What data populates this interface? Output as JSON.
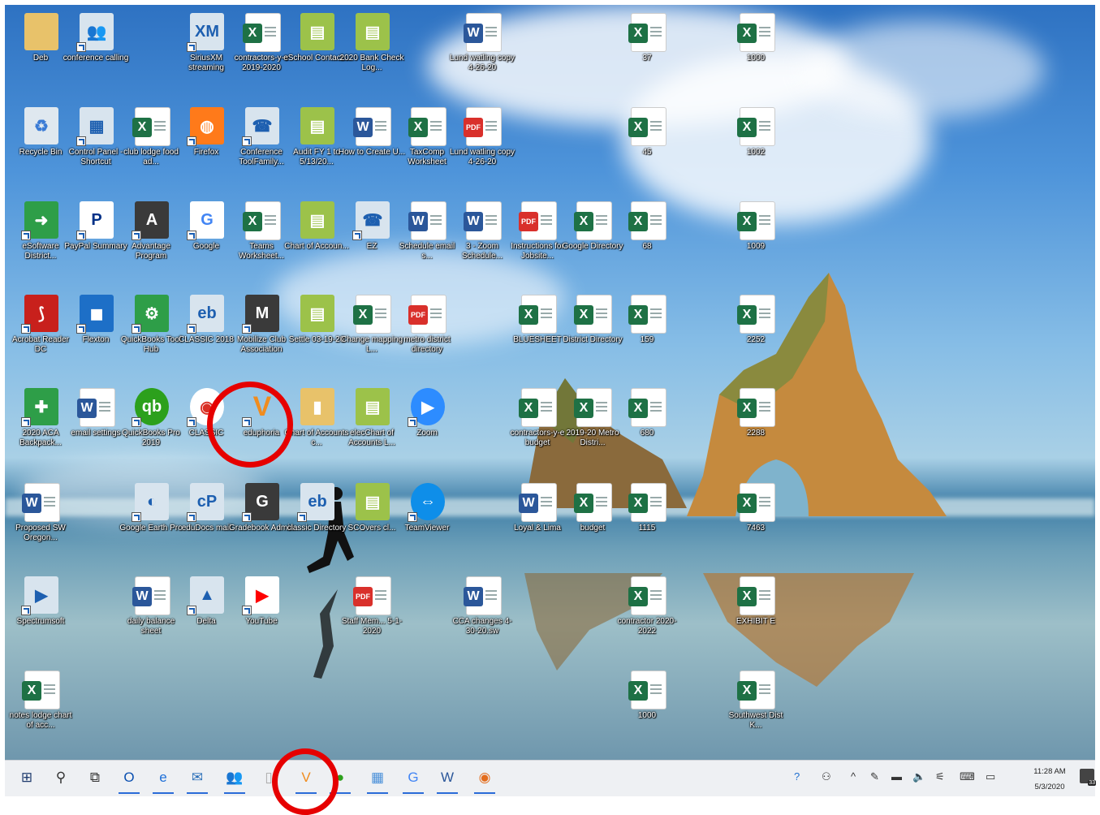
{
  "desktop": {
    "icons": [
      {
        "label": "Deb",
        "icon": "folder-icon",
        "type": "folder",
        "col": 0,
        "row": 0
      },
      {
        "label": "conference calling",
        "icon": "people-icon",
        "type": "app",
        "col": 1,
        "row": 0
      },
      {
        "label": "SiriusXM streaming",
        "icon": "sxm-icon",
        "type": "app",
        "col": 3,
        "row": 0
      },
      {
        "label": "contractors-y-e 2019-2020",
        "icon": "excel-icon",
        "type": "excel",
        "col": 4,
        "row": 0
      },
      {
        "label": "eSchool Contact...",
        "icon": "book-icon",
        "type": "book",
        "col": 5,
        "row": 0
      },
      {
        "label": "2020 Bank Check Log...",
        "icon": "book-icon",
        "type": "book",
        "col": 6,
        "row": 0
      },
      {
        "label": "Lund watling copy 4-26-20",
        "icon": "word-icon",
        "type": "word",
        "col": 8,
        "row": 0
      },
      {
        "label": "37",
        "icon": "excel-icon",
        "type": "excel",
        "col": 11,
        "row": 0
      },
      {
        "label": "1000",
        "icon": "excel-icon",
        "type": "excel",
        "col": 13,
        "row": 0
      },
      {
        "label": "Recycle Bin",
        "icon": "recycle-bin-icon",
        "type": "bin",
        "col": 0,
        "row": 1
      },
      {
        "label": "Control Panel - Shortcut",
        "icon": "control-panel-icon",
        "type": "app",
        "col": 1,
        "row": 1
      },
      {
        "label": "club lodge food ad...",
        "icon": "excel-icon",
        "type": "excel",
        "col": 2,
        "row": 1
      },
      {
        "label": "Firefox",
        "icon": "firefox-icon",
        "type": "firefox",
        "col": 3,
        "row": 1
      },
      {
        "label": "Conference ToolFamily...",
        "icon": "phone-icon",
        "type": "app",
        "col": 4,
        "row": 1
      },
      {
        "label": "Audit FY 1 to 5/13/20...",
        "icon": "book-icon",
        "type": "book",
        "col": 5,
        "row": 1
      },
      {
        "label": "How to Create U...",
        "icon": "word-icon",
        "type": "word",
        "col": 6,
        "row": 1
      },
      {
        "label": "TaxComp Worksheet",
        "icon": "excel-icon",
        "type": "excel",
        "col": 7,
        "row": 1
      },
      {
        "label": "Lund watling copy 4-26-20",
        "icon": "pdf-icon",
        "type": "pdf",
        "col": 8,
        "row": 1
      },
      {
        "label": "45",
        "icon": "excel-icon",
        "type": "excel",
        "col": 11,
        "row": 1
      },
      {
        "label": "1002",
        "icon": "excel-icon",
        "type": "excel",
        "col": 13,
        "row": 1
      },
      {
        "label": "eSoftware District...",
        "icon": "arrow-icon",
        "type": "green",
        "col": 0,
        "row": 2
      },
      {
        "label": "PayPal Summary",
        "icon": "paypal-icon",
        "type": "paypal",
        "col": 1,
        "row": 2
      },
      {
        "label": "Advantage Program",
        "icon": "letter-a-icon",
        "type": "dark",
        "col": 2,
        "row": 2
      },
      {
        "label": "Google",
        "icon": "google-icon",
        "type": "google",
        "col": 3,
        "row": 2
      },
      {
        "label": "Teams Worksheet...",
        "icon": "excel-icon",
        "type": "excel",
        "col": 4,
        "row": 2
      },
      {
        "label": "Chart of Accoun...",
        "icon": "book-icon",
        "type": "book",
        "col": 5,
        "row": 2
      },
      {
        "label": "EZ",
        "icon": "phone-icon",
        "type": "app",
        "col": 6,
        "row": 2
      },
      {
        "label": "Schedule email s...",
        "icon": "word-icon",
        "type": "word",
        "col": 7,
        "row": 2
      },
      {
        "label": "3 - Zoom Schedule...",
        "icon": "word-icon",
        "type": "word",
        "col": 8,
        "row": 2
      },
      {
        "label": "Instructions for Jobsite...",
        "icon": "pdf-icon",
        "type": "pdf",
        "col": 9,
        "row": 2
      },
      {
        "label": "Google Directory",
        "icon": "excel-icon",
        "type": "excel",
        "col": 10,
        "row": 2
      },
      {
        "label": "68",
        "icon": "excel-icon",
        "type": "excel",
        "col": 11,
        "row": 2
      },
      {
        "label": "1009",
        "icon": "excel-icon",
        "type": "excel",
        "col": 13,
        "row": 2
      },
      {
        "label": "Acrobat Reader DC",
        "icon": "acrobat-icon",
        "type": "acrobat",
        "col": 0,
        "row": 3
      },
      {
        "label": "Flexton",
        "icon": "window-icon",
        "type": "blue",
        "col": 1,
        "row": 3
      },
      {
        "label": "QuickBooks Tool Hub",
        "icon": "quickbooks-hub-icon",
        "type": "green",
        "col": 2,
        "row": 3
      },
      {
        "label": "CLASSIC 2018",
        "icon": "classic-icon",
        "type": "app",
        "col": 3,
        "row": 3
      },
      {
        "label": "Mobilize Club Association",
        "icon": "letter-m-icon",
        "type": "dark",
        "col": 4,
        "row": 3
      },
      {
        "label": "Settle 03-19-20",
        "icon": "book-icon",
        "type": "book",
        "col": 5,
        "row": 3
      },
      {
        "label": "Change mapping L...",
        "icon": "excel-icon",
        "type": "excel",
        "col": 6,
        "row": 3
      },
      {
        "label": "metro district directory",
        "icon": "pdf-icon",
        "type": "pdf",
        "col": 7,
        "row": 3
      },
      {
        "label": "BLUESHEET",
        "icon": "excel-icon",
        "type": "excel",
        "col": 9,
        "row": 3
      },
      {
        "label": "District Directory",
        "icon": "excel-icon",
        "type": "excel",
        "col": 10,
        "row": 3
      },
      {
        "label": "159",
        "icon": "excel-icon",
        "type": "excel",
        "col": 11,
        "row": 3
      },
      {
        "label": "2252",
        "icon": "excel-icon",
        "type": "excel",
        "col": 13,
        "row": 3
      },
      {
        "label": "2020 ACA Backpack...",
        "icon": "cross-icon",
        "type": "green",
        "col": 0,
        "row": 4
      },
      {
        "label": "email settings",
        "icon": "word-icon",
        "type": "word",
        "col": 1,
        "row": 4
      },
      {
        "label": "QuickBooks Pro 2019",
        "icon": "quickbooks-icon",
        "type": "qb",
        "col": 2,
        "row": 4
      },
      {
        "label": "CLASSIC",
        "icon": "chrome-icon",
        "type": "chrome",
        "col": 3,
        "row": 4
      },
      {
        "label": "eduphoria",
        "icon": "eduphoria-icon",
        "type": "eduphoria",
        "col": 4,
        "row": 4
      },
      {
        "label": "Chart of Accounts c...",
        "icon": "zip-folder-icon",
        "type": "folder",
        "col": 5,
        "row": 4
      },
      {
        "label": "elecChart of Accounts L...",
        "icon": "book-icon",
        "type": "book",
        "col": 6,
        "row": 4
      },
      {
        "label": "Zoom",
        "icon": "zoom-icon",
        "type": "zoom",
        "col": 7,
        "row": 4
      },
      {
        "label": "contractors-y-e budget",
        "icon": "excel-icon",
        "type": "excel",
        "col": 9,
        "row": 4
      },
      {
        "label": "2019-20 Metro Distri...",
        "icon": "excel-icon",
        "type": "excel",
        "col": 10,
        "row": 4
      },
      {
        "label": "680",
        "icon": "excel-icon",
        "type": "excel",
        "col": 11,
        "row": 4
      },
      {
        "label": "2288",
        "icon": "excel-icon",
        "type": "excel",
        "col": 13,
        "row": 4
      },
      {
        "label": "Proposed SW Oregon...",
        "icon": "word-icon",
        "type": "word",
        "col": 0,
        "row": 5
      },
      {
        "label": "Google Earth Pro",
        "icon": "google-earth-icon",
        "type": "app",
        "col": 2,
        "row": 5
      },
      {
        "label": "eduDocs mail",
        "icon": "cp-icon",
        "type": "app",
        "col": 3,
        "row": 5
      },
      {
        "label": "Gradebook Admin",
        "icon": "letter-g-icon",
        "type": "dark",
        "col": 4,
        "row": 5
      },
      {
        "label": "classic Directory",
        "icon": "classic-icon",
        "type": "app",
        "col": 5,
        "row": 5
      },
      {
        "label": "SCOvers cl...",
        "icon": "book-icon",
        "type": "book",
        "col": 6,
        "row": 5
      },
      {
        "label": "TeamViewer",
        "icon": "teamviewer-icon",
        "type": "teamviewer",
        "col": 7,
        "row": 5
      },
      {
        "label": "Loyal & Lima",
        "icon": "word-icon",
        "type": "word",
        "col": 9,
        "row": 5
      },
      {
        "label": "budget",
        "icon": "excel-icon",
        "type": "excel",
        "col": 10,
        "row": 5
      },
      {
        "label": "1115",
        "icon": "excel-icon",
        "type": "excel",
        "col": 11,
        "row": 5
      },
      {
        "label": "7463",
        "icon": "excel-icon",
        "type": "excel",
        "col": 13,
        "row": 5
      },
      {
        "label": "Spectrumsoft",
        "icon": "play-arrow-icon",
        "type": "app",
        "col": 0,
        "row": 6
      },
      {
        "label": "daily balance sheet",
        "icon": "word-icon",
        "type": "word",
        "col": 2,
        "row": 6
      },
      {
        "label": "Delta",
        "icon": "delta-icon",
        "type": "app",
        "col": 3,
        "row": 6
      },
      {
        "label": "YouTube",
        "icon": "youtube-icon",
        "type": "youtube",
        "col": 4,
        "row": 6
      },
      {
        "label": "Staff Mem... 5-1-2020",
        "icon": "pdf-icon",
        "type": "pdf",
        "col": 6,
        "row": 6
      },
      {
        "label": "CCA changes 4-30-20.sw",
        "icon": "word-icon",
        "type": "word",
        "col": 8,
        "row": 6
      },
      {
        "label": "contractor 2020-2022",
        "icon": "excel-icon",
        "type": "excel",
        "col": 11,
        "row": 6
      },
      {
        "label": "EXHIBIT E",
        "icon": "excel-icon",
        "type": "excel",
        "col": 13,
        "row": 6
      },
      {
        "label": "notes lodge chart of acc...",
        "icon": "excel-icon",
        "type": "excel",
        "col": 0,
        "row": 7
      },
      {
        "label": "1000",
        "icon": "excel-icon",
        "type": "excel",
        "col": 11,
        "row": 7
      },
      {
        "label": "Southwest Dist K...",
        "icon": "excel-icon",
        "type": "excel",
        "col": 13,
        "row": 7
      }
    ]
  },
  "highlight_note": "eduphoria",
  "taskbar": {
    "pinned": [
      {
        "name": "start-button",
        "glyph": "⊞"
      },
      {
        "name": "search-button",
        "glyph": "⚲"
      },
      {
        "name": "task-view-button",
        "glyph": "⧉"
      },
      {
        "name": "outlook-button",
        "glyph": "O"
      },
      {
        "name": "edge-button",
        "glyph": "e"
      },
      {
        "name": "mail-button",
        "glyph": "✉"
      },
      {
        "name": "people-button",
        "glyph": "👥"
      },
      {
        "name": "blank-button",
        "glyph": "▯"
      },
      {
        "name": "eduphoria-taskbar-button",
        "glyph": "V"
      },
      {
        "name": "quickbooks-taskbar-button",
        "glyph": "●"
      },
      {
        "name": "calendar-button",
        "glyph": "▦"
      },
      {
        "name": "google-taskbar-button",
        "glyph": "G"
      },
      {
        "name": "word-taskbar-button",
        "glyph": "W"
      },
      {
        "name": "chrome-taskbar-button",
        "glyph": "◉"
      }
    ],
    "tray": [
      {
        "name": "help-icon",
        "glyph": "?"
      },
      {
        "name": "people-tray-icon",
        "glyph": "⚇"
      },
      {
        "name": "show-hidden-icon",
        "glyph": "^"
      },
      {
        "name": "pen-icon",
        "glyph": "✎"
      },
      {
        "name": "battery-icon",
        "glyph": "▬"
      },
      {
        "name": "volume-icon",
        "glyph": "🔈"
      },
      {
        "name": "network-icon",
        "glyph": "⚟"
      },
      {
        "name": "keyboard-icon",
        "glyph": "⌨"
      },
      {
        "name": "display-icon",
        "glyph": "▭"
      }
    ],
    "clock_time": "11:28 AM",
    "clock_date": "5/3/2020",
    "notifications_count": "33"
  }
}
